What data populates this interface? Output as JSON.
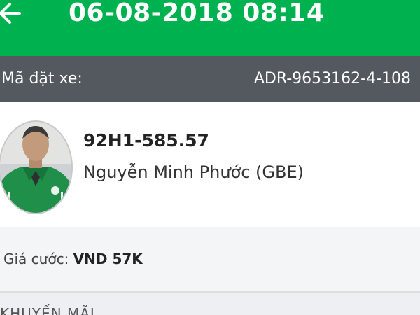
{
  "header": {
    "title": "06-08-2018 08:14",
    "back_icon": "arrow-left-icon",
    "color": "#00b14f"
  },
  "booking": {
    "label": "Mã đặt xe:",
    "code": "ADR-9653162-4-108"
  },
  "driver": {
    "plate": "92H1-585.57",
    "name": "Nguyễn Minh Phước (GBE)",
    "avatar_icon": "driver-photo"
  },
  "fare": {
    "label": "Giá cước:",
    "value": "VND 57K"
  },
  "promo": {
    "label": "KHUYẾN MÃI"
  }
}
